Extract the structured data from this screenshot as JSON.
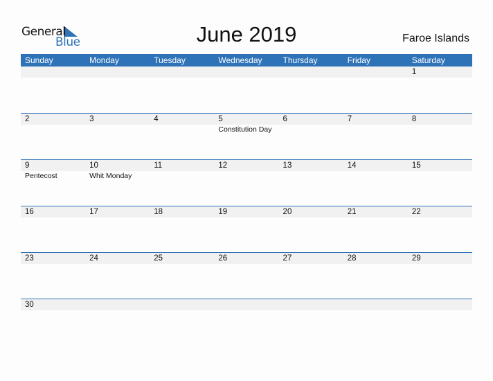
{
  "logo": {
    "line1": "General",
    "line2": "Blue"
  },
  "title": "June 2019",
  "country": "Faroe Islands",
  "weekdays": [
    "Sunday",
    "Monday",
    "Tuesday",
    "Wednesday",
    "Thursday",
    "Friday",
    "Saturday"
  ],
  "weeks": [
    [
      {
        "d": ""
      },
      {
        "d": ""
      },
      {
        "d": ""
      },
      {
        "d": ""
      },
      {
        "d": ""
      },
      {
        "d": ""
      },
      {
        "d": "1"
      }
    ],
    [
      {
        "d": "2"
      },
      {
        "d": "3"
      },
      {
        "d": "4"
      },
      {
        "d": "5",
        "h": "Constitution Day"
      },
      {
        "d": "6"
      },
      {
        "d": "7"
      },
      {
        "d": "8"
      }
    ],
    [
      {
        "d": "9",
        "h": "Pentecost"
      },
      {
        "d": "10",
        "h": "Whit Monday"
      },
      {
        "d": "11"
      },
      {
        "d": "12"
      },
      {
        "d": "13"
      },
      {
        "d": "14"
      },
      {
        "d": "15"
      }
    ],
    [
      {
        "d": "16"
      },
      {
        "d": "17"
      },
      {
        "d": "18"
      },
      {
        "d": "19"
      },
      {
        "d": "20"
      },
      {
        "d": "21"
      },
      {
        "d": "22"
      }
    ],
    [
      {
        "d": "23"
      },
      {
        "d": "24"
      },
      {
        "d": "25"
      },
      {
        "d": "26"
      },
      {
        "d": "27"
      },
      {
        "d": "28"
      },
      {
        "d": "29"
      }
    ],
    [
      {
        "d": "30"
      },
      {
        "d": ""
      },
      {
        "d": ""
      },
      {
        "d": ""
      },
      {
        "d": ""
      },
      {
        "d": ""
      },
      {
        "d": ""
      }
    ]
  ]
}
